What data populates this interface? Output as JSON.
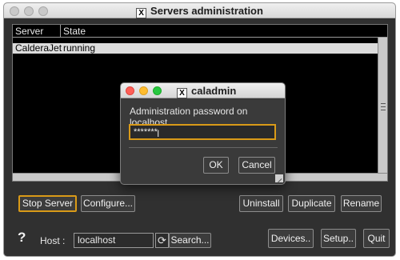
{
  "window": {
    "title": "Servers administration",
    "title_icon": "X"
  },
  "table": {
    "columns": [
      "Server",
      "State"
    ],
    "rows": [
      {
        "server": "CalderaJet",
        "state": "running"
      }
    ]
  },
  "buttons": {
    "stop_server": "Stop Server",
    "configure": "Configure...",
    "uninstall": "Uninstall",
    "duplicate": "Duplicate",
    "rename": "Rename",
    "devices": "Devices..",
    "setup": "Setup..",
    "quit": "Quit"
  },
  "host": {
    "help": "?",
    "label": "Host :",
    "value": "localhost",
    "refresh_icon": "⟳",
    "search": "Search..."
  },
  "dialog": {
    "title": "caladmin",
    "title_icon": "X",
    "prompt": "Administration password on localhost",
    "password_masked": "*******",
    "ok": "OK",
    "cancel": "Cancel"
  },
  "colors": {
    "traffic_close": "#fe5f57",
    "traffic_min": "#febc2e",
    "traffic_max": "#28c840",
    "focus_ring": "#d99a18"
  }
}
